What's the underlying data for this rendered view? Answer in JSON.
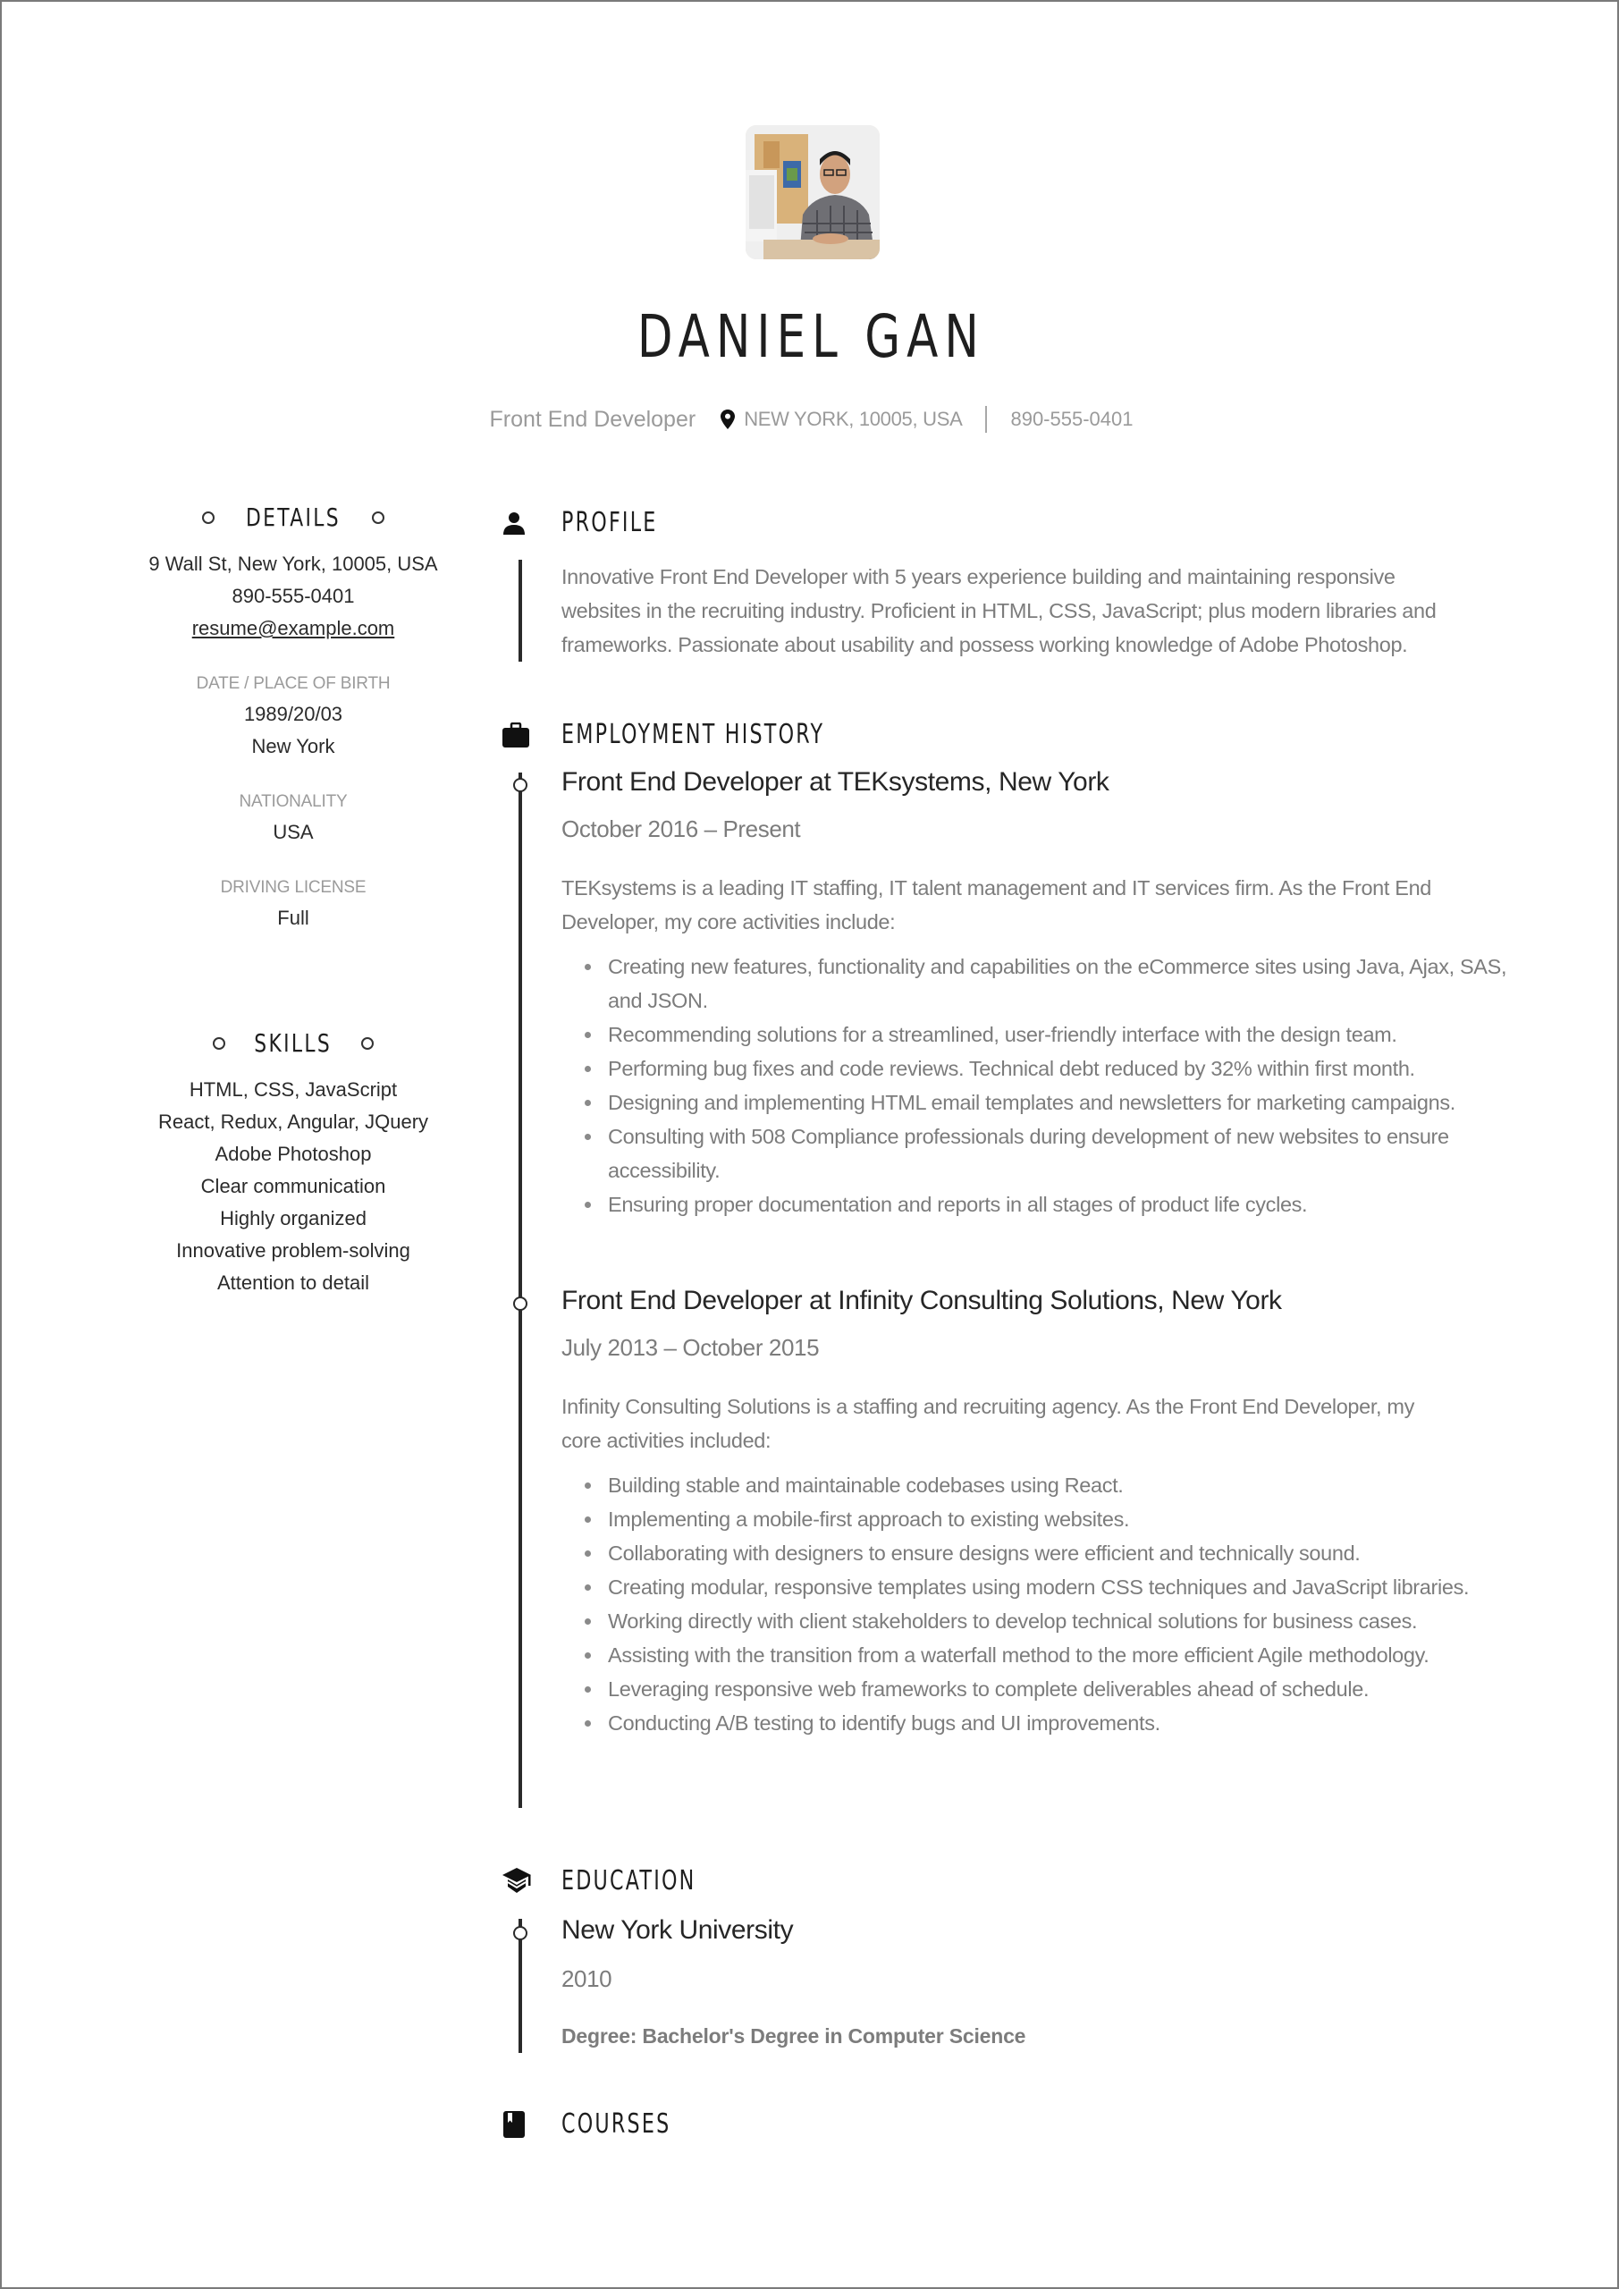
{
  "header": {
    "name": "DANIEL GAN",
    "job_title": "Front End Developer",
    "location": "NEW YORK, 10005, USA",
    "phone": "890-555-0401",
    "photo_alt": "profile-photo"
  },
  "details": {
    "heading": "DETAILS",
    "address": "9 Wall St, New York, 10005, USA",
    "phone": "890-555-0401",
    "email": "resume@example.com",
    "birth_label": "DATE / PLACE OF BIRTH",
    "birth_date": "1989/20/03",
    "birth_place": "New York",
    "nationality_label": "NATIONALITY",
    "nationality": "USA",
    "license_label": "DRIVING LICENSE",
    "license": "Full"
  },
  "skills": {
    "heading": "SKILLS",
    "items": [
      "HTML, CSS, JavaScript",
      "React, Redux, Angular, JQuery",
      "Adobe Photoshop",
      "Clear communication",
      "Highly organized",
      "Innovative problem-solving",
      "Attention to detail"
    ]
  },
  "profile": {
    "heading": "PROFILE",
    "lines": [
      "Innovative Front End Developer with 5 years experience building and maintaining responsive",
      "websites in the recruiting industry. Proficient in HTML, CSS, JavaScript; plus modern libraries and",
      "frameworks. Passionate about usability and possess working knowledge of Adobe Photoshop."
    ]
  },
  "employment": {
    "heading": "EMPLOYMENT HISTORY",
    "jobs": [
      {
        "title": "Front End Developer at TEKsystems, New York",
        "dates": "October 2016 – Present",
        "intro": [
          "TEKsystems is a leading IT staffing, IT talent management and IT services firm. As the Front End",
          "Developer, my core activities include:"
        ],
        "bullets": [
          "Creating new features, functionality and capabilities on the eCommerce sites using Java, Ajax, SAS, and JSON.",
          "Recommending solutions for a streamlined, user-friendly interface with the design team.",
          "Performing bug fixes and code reviews. Technical debt reduced by 32% within first month.",
          "Designing and implementing HTML email templates and newsletters for marketing campaigns.",
          "Consulting with 508 Compliance professionals during development of new websites to ensure accessibility.",
          "Ensuring proper documentation and reports in all stages of product life cycles."
        ]
      },
      {
        "title": "Front End Developer at Infinity Consulting Solutions, New York",
        "dates": "July 2013 – October 2015",
        "intro": [
          "Infinity Consulting Solutions is a staffing and recruiting agency. As the Front End Developer, my",
          "core activities included:"
        ],
        "bullets": [
          "Building stable and maintainable codebases using React.",
          "Implementing a mobile-first approach to existing websites.",
          "Collaborating with designers to ensure designs were efficient and technically sound.",
          "Creating modular, responsive templates using modern CSS techniques and JavaScript libraries.",
          "Working directly with client stakeholders to develop technical solutions for business cases.",
          "Assisting with the transition from a waterfall method to the more efficient Agile methodology.",
          "Leveraging responsive web frameworks to complete deliverables ahead of schedule.",
          "Conducting A/B testing to identify bugs and UI improvements."
        ]
      }
    ]
  },
  "education": {
    "heading": "EDUCATION",
    "school": "New York University",
    "year": "2010",
    "degree": "Degree: Bachelor's Degree in Computer Science"
  },
  "courses": {
    "heading": "COURSES"
  }
}
